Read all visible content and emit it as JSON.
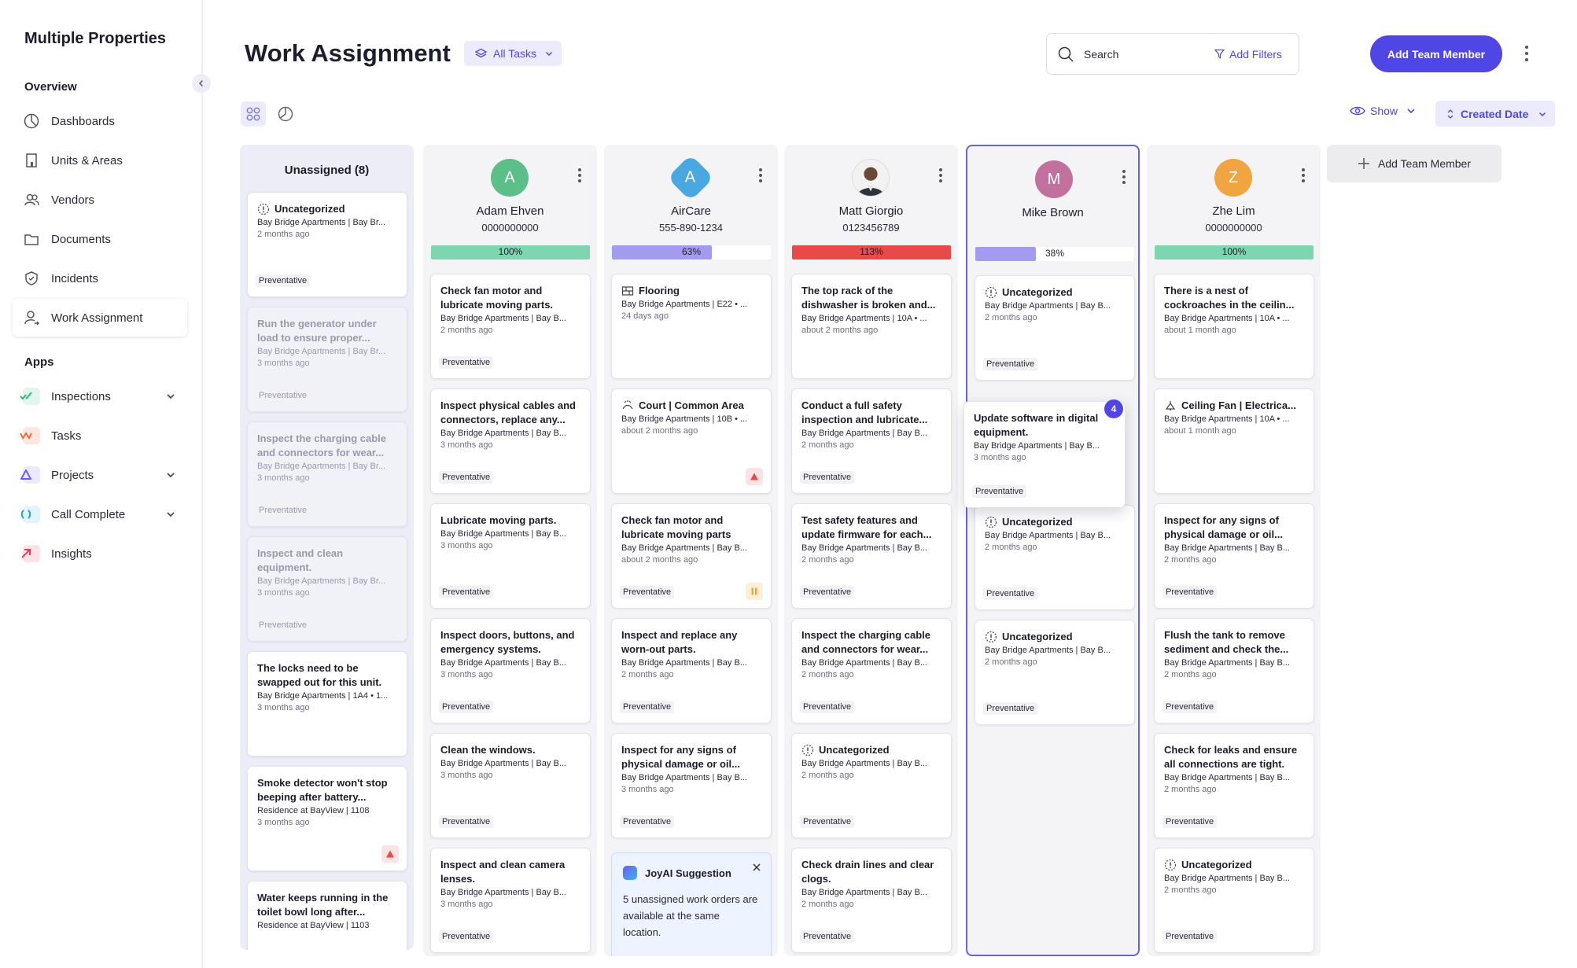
{
  "sidebar": {
    "brand": "Multiple Properties",
    "overview_label": "Overview",
    "overview_items": [
      {
        "label": "Dashboards",
        "icon": "pie-chart-icon"
      },
      {
        "label": "Units & Areas",
        "icon": "building-icon"
      },
      {
        "label": "Vendors",
        "icon": "users-icon"
      },
      {
        "label": "Documents",
        "icon": "folder-icon"
      },
      {
        "label": "Incidents",
        "icon": "shield-icon"
      },
      {
        "label": "Work Assignment",
        "icon": "user-assign-icon",
        "active": true
      }
    ],
    "apps_label": "Apps",
    "app_items": [
      {
        "label": "Inspections",
        "expandable": true,
        "color": "#2fb67c"
      },
      {
        "label": "Tasks",
        "expandable": false,
        "color": "#f06a3a"
      },
      {
        "label": "Projects",
        "expandable": true,
        "color": "#6a5fe8"
      },
      {
        "label": "Call Complete",
        "expandable": true,
        "color": "#1aa6c9"
      },
      {
        "label": "Insights",
        "expandable": false,
        "color": "#e8415a"
      }
    ]
  },
  "header": {
    "title": "Work Assignment",
    "task_filter": "All Tasks",
    "search_placeholder": "Search",
    "add_filters": "Add Filters",
    "add_member_button": "Add Team Member",
    "show_label": "Show",
    "sort_label": "Created Date"
  },
  "colors": {
    "accent": "#4f46e5",
    "progress_green": "#7ed6b0",
    "progress_purple": "#a39bf0",
    "progress_red": "#e84a4a"
  },
  "columns": [
    {
      "type": "unassigned",
      "title": "Unassigned (8)",
      "cards": [
        {
          "title": "Uncategorized",
          "icon": "dashed-alert-icon",
          "location": "Bay Bridge Apartments | Bay Br...",
          "time": "2 months ago",
          "tag": "Preventative"
        },
        {
          "title": "Run the generator under load to ensure proper...",
          "location": "Bay Bridge Apartments | Bay Br...",
          "time": "3 months ago",
          "tag": "Preventative",
          "faded": true
        },
        {
          "title": "Inspect the charging cable and connectors for wear...",
          "location": "Bay Bridge Apartments | Bay Br...",
          "time": "3 months ago",
          "tag": "Preventative",
          "faded": true
        },
        {
          "title": "Inspect and clean equipment.",
          "location": "Bay Bridge Apartments | Bay Br...",
          "time": "3 months ago",
          "tag": "Preventative",
          "faded": true
        },
        {
          "title": "The locks need to be swapped out for this unit.",
          "location": "Bay Bridge Apartments | 1A4 • 1...",
          "time": "3 months ago"
        },
        {
          "title": "Smoke detector won't stop beeping after battery...",
          "location": "Residence at BayView | 1108",
          "time": "3 months ago",
          "flag": "high"
        },
        {
          "title": "Water keeps running in the toilet bowl long after...",
          "location": "Residence at BayView | 1103",
          "time": ""
        }
      ]
    },
    {
      "type": "member",
      "name": "Adam Ehven",
      "phone": "0000000000",
      "initial": "A",
      "avatar_color": "#5cbf8a",
      "progress": "100%",
      "progress_value": 100,
      "progress_color": "#7ed6b0",
      "cards": [
        {
          "title": "Check fan motor and lubricate moving parts.",
          "location": "Bay Bridge Apartments | Bay B...",
          "time": "2 months ago",
          "tag": "Preventative"
        },
        {
          "title": "Inspect physical cables and connectors, replace any...",
          "location": "Bay Bridge Apartments | Bay B...",
          "time": "3 months ago",
          "tag": "Preventative"
        },
        {
          "title": "Lubricate moving parts.",
          "location": "Bay Bridge Apartments | Bay B...",
          "time": "3 months ago",
          "tag": "Preventative"
        },
        {
          "title": "Inspect doors, buttons, and emergency systems.",
          "location": "Bay Bridge Apartments | Bay B...",
          "time": "3 months ago",
          "tag": "Preventative"
        },
        {
          "title": "Clean the windows.",
          "location": "Bay Bridge Apartments | Bay B...",
          "time": "3 months ago",
          "tag": "Preventative"
        },
        {
          "title": "Inspect and clean camera lenses.",
          "location": "Bay Bridge Apartments | Bay B...",
          "time": "3 months ago",
          "tag": "Preventative"
        }
      ]
    },
    {
      "type": "member",
      "name": "AirCare",
      "phone": "555-890-1234",
      "initial": "A",
      "avatar_color": "#4aa8e0",
      "diamond": true,
      "progress": "63%",
      "progress_value": 63,
      "progress_color": "#a39bf0",
      "cards": [
        {
          "title": "Flooring",
          "icon": "floor-icon",
          "location": "Bay Bridge Apartments | E22 • ...",
          "time": "24 days ago"
        },
        {
          "title": "Court | Common Area",
          "icon": "court-icon",
          "location": "Bay Bridge Apartments | 10B • ...",
          "time": "about 2 months ago",
          "flag": "high"
        },
        {
          "title": "Check fan motor and lubricate moving parts",
          "location": "Bay Bridge Apartments | Bay B...",
          "time": "about 2 months ago",
          "tag": "Preventative",
          "flag": "pause"
        },
        {
          "title": "Inspect and replace any worn-out parts.",
          "location": "Bay Bridge Apartments | Bay B...",
          "time": "2 months ago",
          "tag": "Preventative"
        },
        {
          "title": "Inspect for any signs of physical damage or oil...",
          "location": "Bay Bridge Apartments | Bay B...",
          "time": "3 months ago",
          "tag": "Preventative"
        }
      ],
      "suggestion": {
        "title": "JoyAI Suggestion",
        "text": "5 unassigned work orders are available at the same location."
      }
    },
    {
      "type": "member",
      "name": "Matt Giorgio",
      "phone": "0123456789",
      "photo": true,
      "progress": "113%",
      "progress_value": 113,
      "progress_color": "#e84a4a",
      "cards": [
        {
          "title": "The top rack of the dishwasher is broken and...",
          "location": "Bay Bridge Apartments | 10A • ...",
          "time": "about 2 months ago"
        },
        {
          "title": "Conduct a full safety inspection and lubricate...",
          "location": "Bay Bridge Apartments | Bay B...",
          "time": "2 months ago",
          "tag": "Preventative"
        },
        {
          "title": "Test safety features and update firmware for each...",
          "location": "Bay Bridge Apartments | Bay B...",
          "time": "2 months ago",
          "tag": "Preventative"
        },
        {
          "title": "Inspect the charging cable and connectors for wear...",
          "location": "Bay Bridge Apartments | Bay B...",
          "time": "2 months ago",
          "tag": "Preventative"
        },
        {
          "title": "Uncategorized",
          "icon": "dashed-alert-icon",
          "location": "Bay Bridge Apartments | Bay B...",
          "time": "2 months ago",
          "tag": "Preventative"
        },
        {
          "title": "Check drain lines and clear clogs.",
          "location": "Bay Bridge Apartments | Bay B...",
          "time": "2 months ago",
          "tag": "Preventative"
        }
      ]
    },
    {
      "type": "member",
      "name": "Mike Brown",
      "phone": "",
      "initial": "M",
      "avatar_color": "#c2719e",
      "selected": true,
      "progress": "38%",
      "progress_value": 38,
      "progress_color": "#a39bf0",
      "cards": [
        {
          "title": "Uncategorized",
          "icon": "dashed-alert-icon",
          "location": "Bay Bridge Apartments | Bay B...",
          "time": "2 months ago",
          "tag": "Preventative"
        },
        {
          "title": "",
          "location": "",
          "time": "",
          "spacer": true
        },
        {
          "title": "Uncategorized",
          "icon": "dashed-alert-icon",
          "location": "Bay Bridge Apartments | Bay B...",
          "time": "2 months ago",
          "tag": "Preventative"
        },
        {
          "title": "Uncategorized",
          "icon": "dashed-alert-icon",
          "location": "Bay Bridge Apartments | Bay B...",
          "time": "2 months ago",
          "tag": "Preventative"
        }
      ]
    },
    {
      "type": "member",
      "name": "Zhe Lim",
      "phone": "0000000000",
      "initial": "Z",
      "avatar_color": "#f0a540",
      "progress": "100%",
      "progress_value": 100,
      "progress_color": "#7ed6b0",
      "cards": [
        {
          "title": "There is a nest of cockroaches in the ceilin...",
          "location": "Bay Bridge Apartments | 10A • ...",
          "time": "about 1 month ago"
        },
        {
          "title": "Ceiling Fan | Electrica...",
          "icon": "fan-icon",
          "location": "Bay Bridge Apartments | 10A • ...",
          "time": "about 1 month ago"
        },
        {
          "title": "Inspect for any signs of physical damage or oil...",
          "location": "Bay Bridge Apartments | Bay B...",
          "time": "2 months ago",
          "tag": "Preventative"
        },
        {
          "title": "Flush the tank to remove sediment and check the...",
          "location": "Bay Bridge Apartments | Bay B...",
          "time": "2 months ago",
          "tag": "Preventative"
        },
        {
          "title": "Check for leaks and ensure all connections are tight.",
          "location": "Bay Bridge Apartments | Bay B...",
          "time": "2 months ago",
          "tag": "Preventative"
        },
        {
          "title": "Uncategorized",
          "icon": "dashed-alert-icon",
          "location": "Bay Bridge Apartments | Bay B...",
          "time": "2 months ago",
          "tag": "Preventative"
        }
      ]
    }
  ],
  "dragging_card": {
    "title": "Update software in digital equipment.",
    "location": "Bay Bridge Apartments | Bay B...",
    "time": "3 months ago",
    "tag": "Preventative",
    "badge": "4"
  },
  "add_column_label": "Add Team Member"
}
